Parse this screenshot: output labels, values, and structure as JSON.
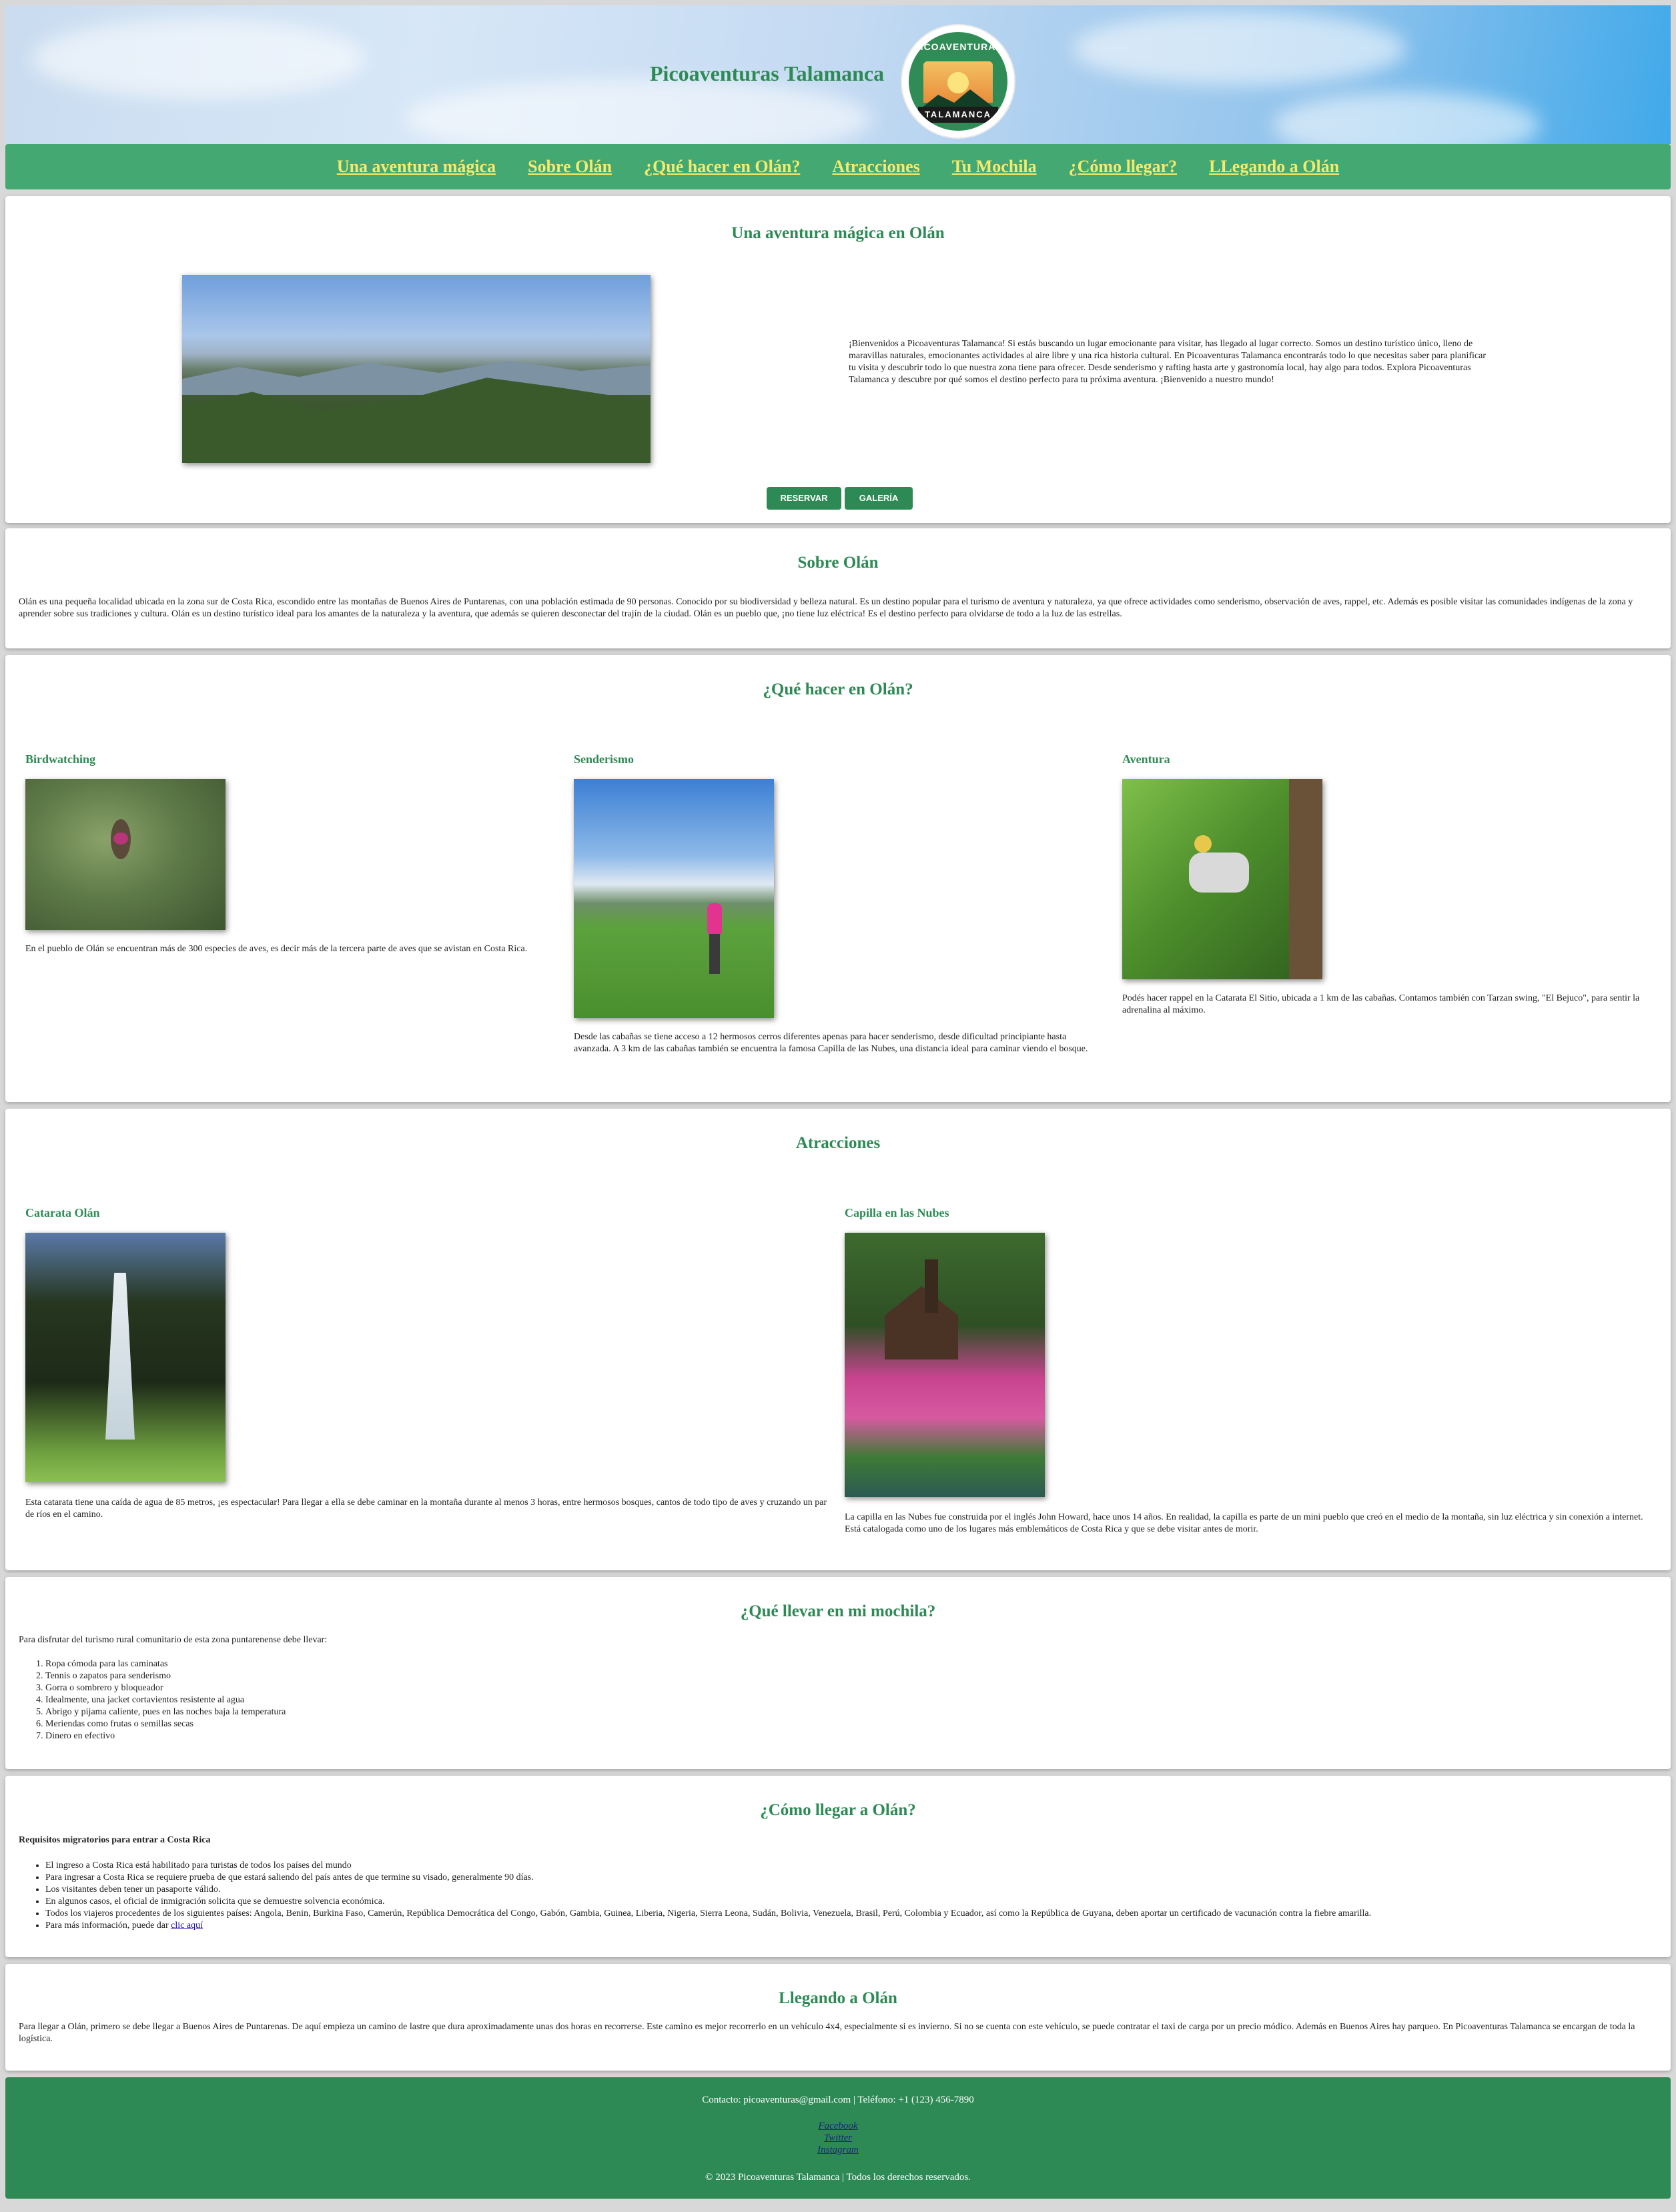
{
  "header": {
    "brand": "Picoaventuras Talamanca",
    "logo_top": "PICOAVENTURAS",
    "logo_bottom": "TALAMANCA"
  },
  "nav": [
    "Una aventura mágica",
    "Sobre Olán",
    "¿Qué hacer en Olán?",
    "Atracciones",
    "Tu Mochila",
    "¿Cómo llegar?",
    "LLegando a Olán"
  ],
  "intro": {
    "title": "Una aventura mágica en Olán",
    "text": "¡Bienvenidos a Picoaventuras Talamanca! Si estás buscando un lugar emocionante para visitar, has llegado al lugar correcto. Somos un destino turístico único, lleno de maravillas naturales, emocionantes actividades al aire libre y una rica historia cultural. En Picoaventuras Talamanca encontrarás todo lo que necesitas saber para planificar tu visita y descubrir todo lo que nuestra zona tiene para ofrecer. Desde senderismo y rafting hasta arte y gastronomía local, hay algo para todos. Explora Picoaventuras Talamanca y descubre por qué somos el destino perfecto para tu próxima aventura. ¡Bienvenido a nuestro mundo!",
    "btn_reservar": "RESERVAR",
    "btn_galeria": "GALERÍA"
  },
  "sobre": {
    "title": "Sobre Olán",
    "text": "Olán es una pequeña localidad ubicada en la zona sur de Costa Rica, escondido entre las montañas de Buenos Aires de Puntarenas, con una población estimada de 90 personas. Conocido por su biodiversidad y belleza natural. Es un destino popular para el turismo de aventura y naturaleza, ya que ofrece actividades como senderismo, observación de aves, rappel, etc. Además es posible visitar las comunidades indígenas de la zona y aprender sobre sus tradiciones y cultura. Olán es un destino turístico ideal para los amantes de la naturaleza y la aventura, que además se quieren desconectar del trajín de la ciudad. Olán es un pueblo que, ¡no tiene luz eléctrica! Es el destino perfecto para olvidarse de todo a la luz de las estrellas."
  },
  "que_hacer": {
    "title": "¿Qué hacer en Olán?",
    "items": [
      {
        "title": "Birdwatching",
        "text": "En el pueblo de Olán se encuentran más de 300 especies de aves, es decir más de la tercera parte de aves que se avistan en Costa Rica."
      },
      {
        "title": "Senderismo",
        "text": "Desde las cabañas se tiene acceso a 12 hermosos cerros diferentes apenas para hacer senderismo, desde dificultad principiante hasta avanzada. A 3 km de las cabañas también se encuentra la famosa Capilla de las Nubes, una distancia ideal para caminar viendo el bosque."
      },
      {
        "title": "Aventura",
        "text": "Podés hacer rappel en la Catarata El Sitio, ubicada a 1 km de las cabañas. Contamos también con Tarzan swing, \"El Bejuco\", para sentir la adrenalina al máximo."
      }
    ]
  },
  "atracciones": {
    "title": "Atracciones",
    "items": [
      {
        "title": "Catarata Olán",
        "text": "Esta catarata tiene una caída de agua de 85 metros, ¡es espectacular! Para llegar a ella se debe caminar en la montaña durante al menos 3 horas, entre hermosos bosques, cantos de todo tipo de aves y cruzando un par de ríos en el camino."
      },
      {
        "title": "Capilla en las Nubes",
        "text": "La capilla en las Nubes fue construida por el inglés John Howard, hace unos 14 años. En realidad, la capilla es parte de un mini pueblo que creó en el medio de la montaña, sin luz eléctrica y sin conexión a internet. Está catalogada como uno de los lugares más emblemáticos de Costa Rica y que se debe visitar antes de morir."
      }
    ]
  },
  "mochila": {
    "title": "¿Qué llevar en mi mochila?",
    "intro": "Para disfrutar del turismo rural comunitario de esta zona puntarenense debe llevar:",
    "items": [
      "Ropa cómoda para las caminatas",
      "Tennis o zapatos para senderismo",
      "Gorra o sombrero y bloqueador",
      "Idealmente, una jacket cortavientos resistente al agua",
      "Abrigo y pijama caliente, pues en las noches baja la temperatura",
      "Meriendas como frutas o semillas secas",
      "Dinero en efectivo"
    ]
  },
  "como_llegar": {
    "title": "¿Cómo llegar a Olán?",
    "subtitle": "Requisitos migratorios para entrar a Costa Rica",
    "items": [
      "El ingreso a Costa Rica está habilitado para turistas de todos los países del mundo",
      "Para ingresar a Costa Rica se requiere prueba de que estará saliendo del país antes de que termine su visado, generalmente 90 días.",
      "Los visitantes deben tener un pasaporte válido.",
      "En algunos casos, el oficial de inmigración solicita que se demuestre solvencia económica.",
      "Todos los viajeros procedentes de los siguientes países: Angola, Benin, Burkina Faso, Camerún, República Democrática del Congo, Gabón, Gambia, Guinea, Liberia, Nigeria, Sierra Leona, Sudán, Bolivia, Venezuela, Brasil, Perú, Colombia y Ecuador, así como la República de Guyana, deben aportar un certificado de vacunación contra la fiebre amarilla."
    ],
    "more_prefix": "Para más información, puede dar ",
    "more_link": "clic aquí"
  },
  "llegando": {
    "title": "Llegando a Olán",
    "text": "Para llegar a Olán, primero se debe llegar a Buenos Aires de Puntarenas. De aquí empieza un camino de lastre que dura aproximadamente unas dos horas en recorrerse. Este camino es mejor recorrerlo en un vehículo 4x4, especialmente si es invierno. Si no se cuenta con este vehículo, se puede contratar el taxi de carga por un precio módico. Además en Buenos Aires hay parqueo. En Picoaventuras Talamanca se encargan de toda la logística."
  },
  "footer": {
    "contact": "Contacto: picoaventuras@gmail.com | Teléfono: +1 (123) 456-7890",
    "social": [
      "Facebook",
      "Twitter",
      "Instagram"
    ],
    "copyright": "© 2023 Picoaventuras Talamanca | Todos los derechos reservados."
  },
  "colors": {
    "brand_green": "#2e8a55",
    "nav_green": "#43a872",
    "nav_link": "#f6ea6c"
  }
}
